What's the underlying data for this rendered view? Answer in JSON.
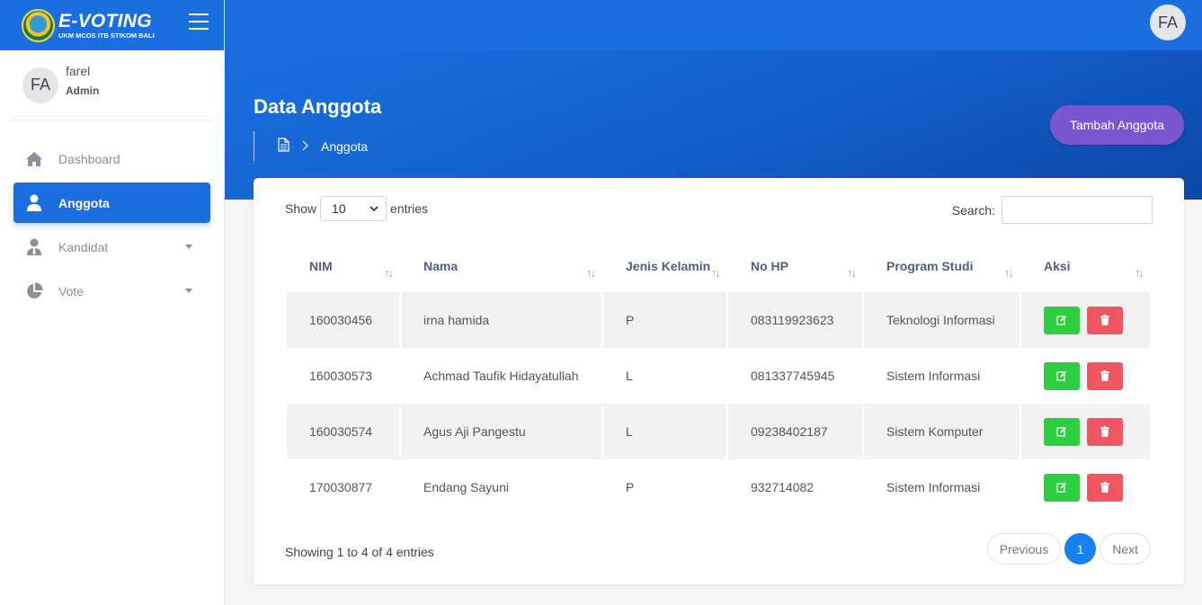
{
  "brand": {
    "title": "E-VOTING",
    "subtitle": "UKM MCOS ITB STIKOM BALI"
  },
  "user": {
    "initials": "FA",
    "name": "farel",
    "role": "Admin"
  },
  "sidebar": {
    "items": [
      {
        "label": "Dashboard",
        "icon": "home-icon"
      },
      {
        "label": "Anggota",
        "icon": "user-icon"
      },
      {
        "label": "Kandidat",
        "icon": "user-tie-icon"
      },
      {
        "label": "Vote",
        "icon": "pie-chart-icon"
      }
    ]
  },
  "header": {
    "title": "Data Anggota",
    "breadcrumb": "Anggota",
    "add_button": "Tambah Anggota"
  },
  "table": {
    "show_label": "Show",
    "entries_label": "entries",
    "length_value": "10",
    "search_label": "Search:",
    "columns": [
      "NIM",
      "Nama",
      "Jenis Kelamin",
      "No HP",
      "Program Studi",
      "Aksi"
    ],
    "rows": [
      [
        "160030456",
        "irna hamida",
        "P",
        "083119923623",
        "Teknologi Informasi"
      ],
      [
        "160030573",
        "Achmad Taufik Hidayatullah",
        "L",
        "081337745945",
        "Sistem Informasi"
      ],
      [
        "160030574",
        "Agus Aji Pangestu",
        "L",
        "09238402187",
        "Sistem Komputer"
      ],
      [
        "170030877",
        "Endang Sayuni",
        "P",
        "932714082",
        "Sistem Informasi"
      ]
    ],
    "info": "Showing 1 to 4 of 4 entries",
    "pagination": {
      "previous": "Previous",
      "current": "1",
      "next": "Next"
    }
  },
  "colors": {
    "primary": "#1a6fe0",
    "purple": "#7a57d1",
    "edit": "#2dce3f",
    "delete": "#f05560"
  }
}
